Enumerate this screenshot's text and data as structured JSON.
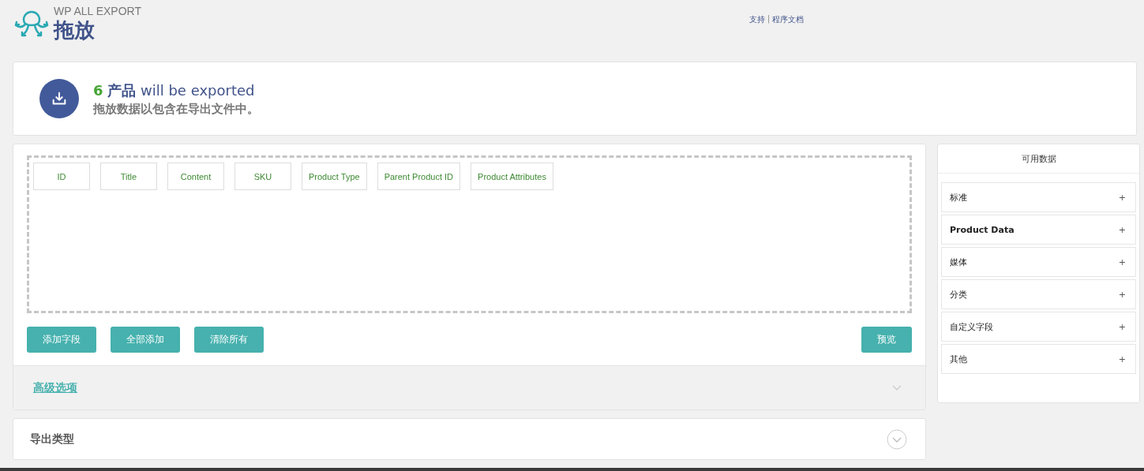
{
  "header": {
    "brand": "WP ALL EXPORT",
    "title": "拖放",
    "links": [
      "支持",
      "程序文档"
    ],
    "separator": "|"
  },
  "summary": {
    "count": "6",
    "noun": "产品",
    "rest": "will be exported",
    "subtitle": "拖放数据以包含在导出文件中。"
  },
  "fields": [
    "ID",
    "Title",
    "Content",
    "SKU",
    "Product Type",
    "Parent Product ID",
    "Product Attributes"
  ],
  "buttons_left": [
    "添加字段",
    "全部添加",
    "清除所有"
  ],
  "button_right": "预览",
  "advanced": {
    "label": "高级选项",
    "expanded": false
  },
  "export_type": {
    "label": "导出类型",
    "expanded": false
  },
  "sidebar": {
    "title": "可用数据",
    "items": [
      {
        "label": "标准",
        "bold": false,
        "toggle": "+"
      },
      {
        "label": "Product Data",
        "bold": true,
        "toggle": "+"
      },
      {
        "label": "媒体",
        "bold": false,
        "toggle": "+"
      },
      {
        "label": "分类",
        "bold": false,
        "toggle": "+"
      },
      {
        "label": "自定义字段",
        "bold": false,
        "toggle": "+"
      },
      {
        "label": "其他",
        "bold": false,
        "toggle": "+"
      }
    ]
  }
}
